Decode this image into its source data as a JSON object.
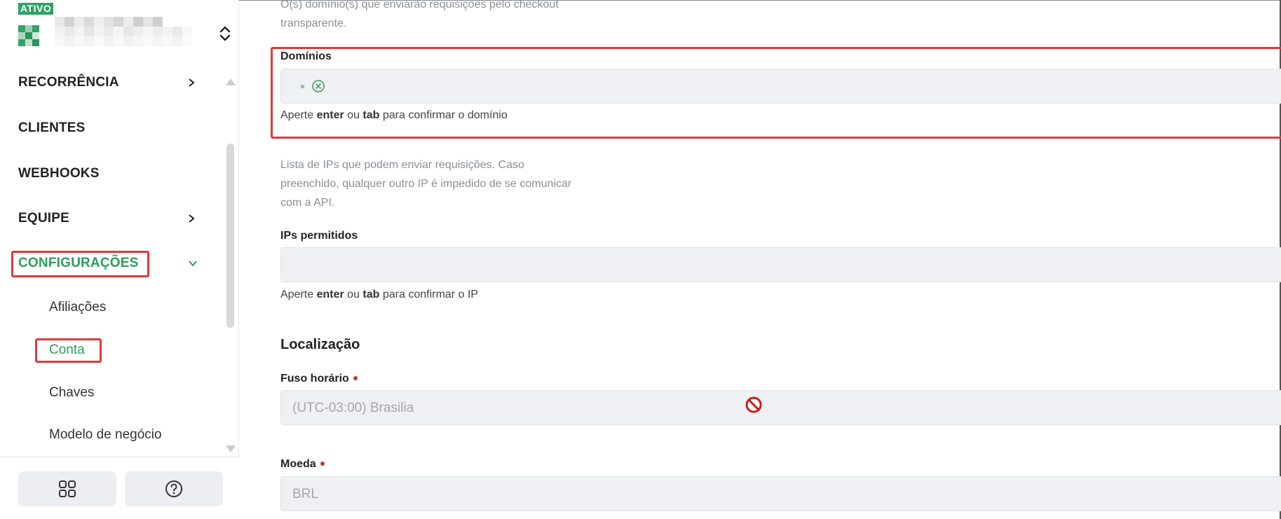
{
  "sidebar": {
    "status_badge": "ATIVO",
    "nav": {
      "recorrencia": "RECORRÊNCIA",
      "clientes": "CLIENTES",
      "webhooks": "WEBHOOKS",
      "equipe": "EQUIPE",
      "configuracoes": "CONFIGURAÇÕES"
    },
    "sub_items": {
      "afiliacoes": "Afiliações",
      "conta": "Conta",
      "chaves": "Chaves",
      "modelo_negocio": "Modelo de negócio"
    },
    "bottom_buttons": {
      "apps_icon": "grid-icon",
      "help_icon": "help-icon"
    }
  },
  "main": {
    "dominios": {
      "help_line1": "O(s) domínio(s) que enviarão requisições pelo checkout",
      "help_line2": "transparente.",
      "label": "Domínios",
      "hint_prefix": "Aperte",
      "hint_key1": "enter",
      "hint_mid": "ou",
      "hint_key2": "tab",
      "hint_suffix": "para confirmar o domínio"
    },
    "ips": {
      "help_line1": "Lista de IPs que podem enviar requisições. Caso",
      "help_line2": "preenchido, qualquer outro IP é impedido de se comunicar",
      "help_line3": "com a API.",
      "label": "IPs permitidos",
      "hint_prefix": "Aperte",
      "hint_key1": "enter",
      "hint_mid": "ou",
      "hint_key2": "tab",
      "hint_suffix": "para confirmar o IP"
    },
    "localizacao": {
      "title": "Localização",
      "fuso_label": "Fuso horário",
      "fuso_value": "(UTC-03:00) Brasilia",
      "moeda_label": "Moeda",
      "moeda_value": "BRL"
    }
  },
  "colors": {
    "accent_green": "#2e9b5d",
    "highlight_red": "#dd3b3b",
    "input_bg": "#eef0f3",
    "required_dot": "#c0392b"
  }
}
